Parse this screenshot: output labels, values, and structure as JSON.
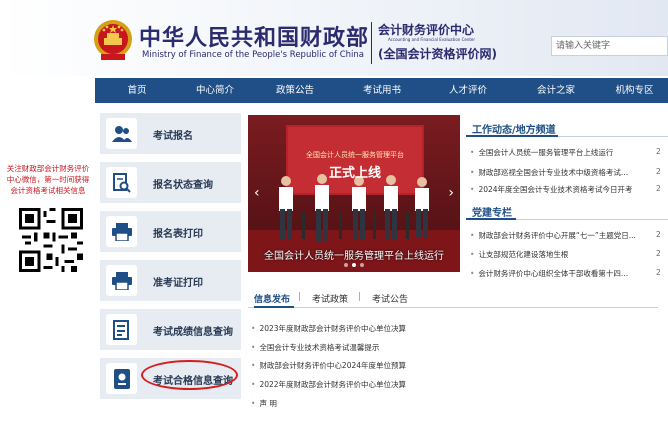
{
  "header": {
    "title_cn": "中华人民共和国财政部",
    "title_en": "Ministry of Finance of the People's Republic of China",
    "subtitle_1": "会计财务评价中心",
    "subtitle_en": "Accounting and Financial Evaluation Center",
    "subtitle_2": "(全国会计资格评价网)",
    "search_placeholder": "请输入关键字"
  },
  "nav": [
    "首页",
    "中心简介",
    "政策公告",
    "考试用书",
    "人才评价",
    "会计之家",
    "机构专区"
  ],
  "side": {
    "notice": "关注财政部会计财务评价中心微信，第一时间获得会计资格考试相关信息"
  },
  "services": [
    {
      "label": "考试报名",
      "icon": "users-icon"
    },
    {
      "label": "报名状态查询",
      "icon": "document-search-icon"
    },
    {
      "label": "报名表打印",
      "icon": "printer-icon"
    },
    {
      "label": "准考证打印",
      "icon": "printer-icon"
    },
    {
      "label": "考试成绩信息查询",
      "icon": "document-list-icon"
    },
    {
      "label": "考试合格信息查询",
      "icon": "certificate-icon"
    }
  ],
  "carousel": {
    "caption": "全国会计人员统一服务管理平台上线运行",
    "banner_top": "全国会计人员统一服务管理平台",
    "banner_main": "正式上线",
    "active_slide": 2,
    "slide_count": 3
  },
  "work_news": {
    "title": "工作动态/地方频道",
    "items": [
      {
        "text": "全国会计人员统一服务管理平台上线运行",
        "date": "2"
      },
      {
        "text": "财政部巡视全国会计专业技术中级资格考试...",
        "date": "2"
      },
      {
        "text": "2024年度全国会计专业技术资格考试今日开考",
        "date": "2"
      }
    ]
  },
  "party": {
    "title": "党建专栏",
    "items": [
      {
        "text": "财政部会计财务评价中心开展“七一”主题党日...",
        "date": "2"
      },
      {
        "text": "让支部规范化建设落地生根",
        "date": "2"
      },
      {
        "text": "会计财务评价中心组织全体干部收看第十四...",
        "date": "2"
      }
    ]
  },
  "info": {
    "tabs": [
      "信息发布",
      "考试政策",
      "考试公告"
    ],
    "items": [
      "2023年度财政部会计财务评价中心单位决算",
      "全国会计专业技术资格考试温馨提示",
      "财政部会计财务评价中心2024年度单位预算",
      "2022年度财政部会计财务评价中心单位决算",
      "声 明"
    ]
  },
  "colors": {
    "nav_bg": "#1f4f86",
    "accent_red": "#c8161d",
    "service_bg": "#e7ecf3"
  }
}
